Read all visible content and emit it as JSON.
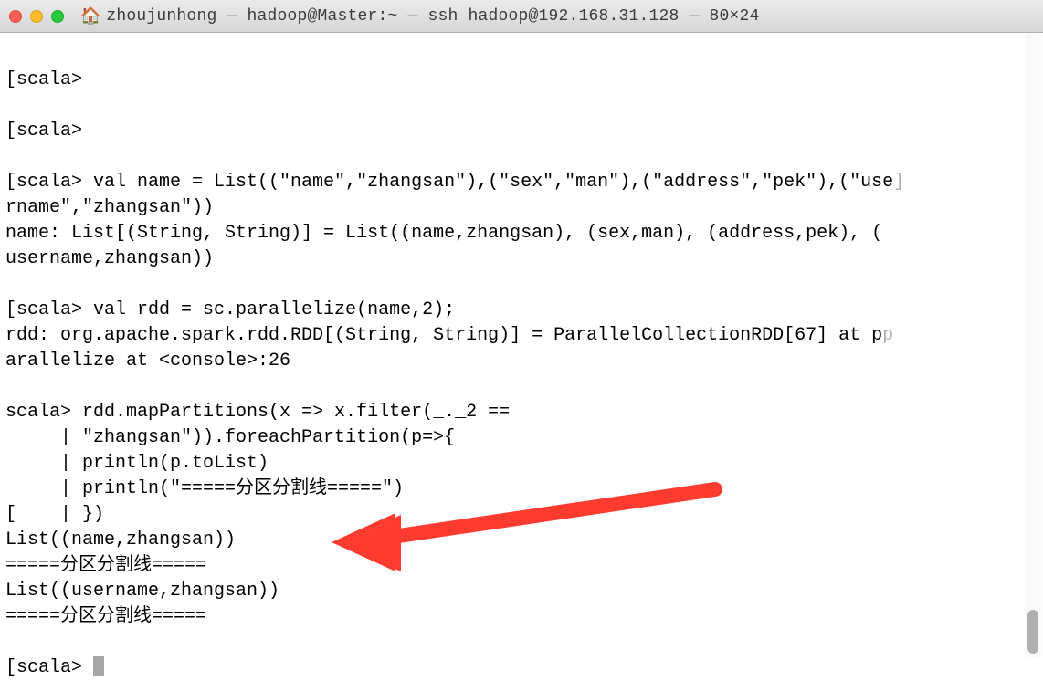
{
  "titlebar": {
    "title": "zhoujunhong — hadoop@Master:~ — ssh hadoop@192.168.31.128 — 80×24"
  },
  "terminal": {
    "lines": [
      "[scala>",
      "",
      "[scala>",
      "",
      "[scala> val name = List((\"name\",\"zhangsan\"),(\"sex\",\"man\"),(\"address\",\"pek\"),(\"use",
      "rname\",\"zhangsan\"))",
      "name: List[(String, String)] = List((name,zhangsan), (sex,man), (address,pek), (",
      "username,zhangsan))",
      "",
      "[scala> val rdd = sc.parallelize(name,2);",
      "rdd: org.apache.spark.rdd.RDD[(String, String)] = ParallelCollectionRDD[67] at p",
      "arallelize at <console>:26",
      "",
      "scala> rdd.mapPartitions(x => x.filter(_._2 ==",
      "     | \"zhangsan\")).foreachPartition(p=>{",
      "     | println(p.toList)",
      "     | println(\"=====分区分割线=====\")",
      "[    | })",
      "List((name,zhangsan))",
      "=====分区分割线=====",
      "List((username,zhangsan))",
      "=====分区分割线=====",
      ""
    ],
    "prompt": "[scala> ",
    "line4_faded": "]",
    "line9_faded": "p"
  },
  "annotation": {
    "type": "arrow",
    "color": "#ff3b30"
  }
}
